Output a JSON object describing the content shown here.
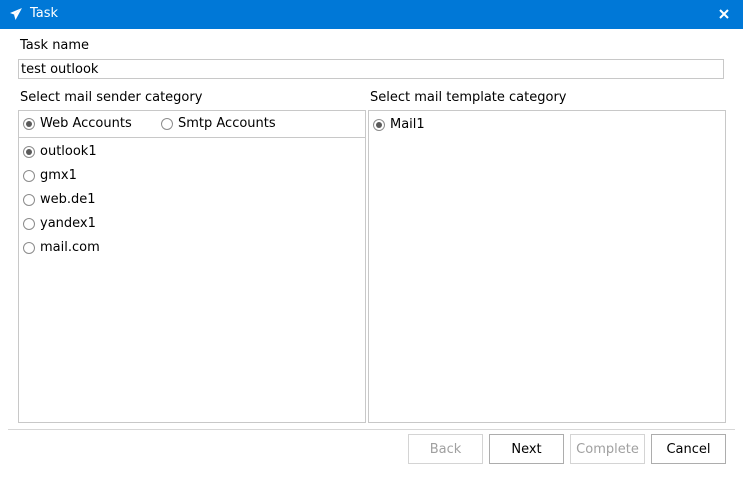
{
  "window": {
    "title": "Task"
  },
  "task_name": {
    "label": "Task name",
    "value": "test outlook"
  },
  "sender": {
    "label": "Select mail sender category",
    "types": [
      {
        "label": "Web Accounts",
        "selected": true
      },
      {
        "label": "Smtp Accounts",
        "selected": false
      }
    ],
    "accounts": [
      {
        "label": "outlook1",
        "selected": true
      },
      {
        "label": "gmx1",
        "selected": false
      },
      {
        "label": "web.de1",
        "selected": false
      },
      {
        "label": "yandex1",
        "selected": false
      },
      {
        "label": "mail.com",
        "selected": false
      }
    ]
  },
  "template": {
    "label": "Select mail template category",
    "items": [
      {
        "label": "Mail1",
        "selected": true
      }
    ]
  },
  "buttons": {
    "back": "Back",
    "next": "Next",
    "complete": "Complete",
    "cancel": "Cancel"
  }
}
